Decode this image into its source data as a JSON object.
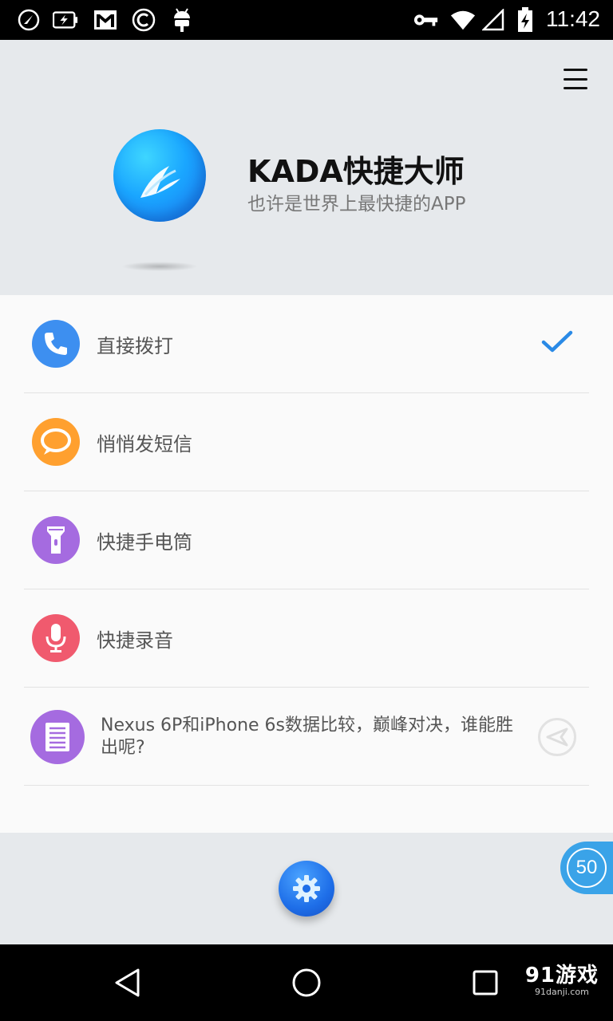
{
  "status_bar": {
    "time": "11:42",
    "left_icons": [
      "quick-app-icon",
      "battery-saver-icon",
      "gmail-icon",
      "copyright-app-icon",
      "android-debug-icon"
    ],
    "right_icons": [
      "vpn-key-icon",
      "wifi-icon",
      "cell-signal-icon",
      "battery-charging-icon"
    ]
  },
  "header": {
    "app_name": "KADA快捷大师",
    "tagline": "也许是世界上最快捷的APP",
    "colors": {
      "logo": "#1aa6ff",
      "background": "#e6e9ec"
    }
  },
  "items": [
    {
      "label": "直接拨打",
      "icon": "phone-icon",
      "color": "#3d8ff0",
      "checked": true
    },
    {
      "label": "悄悄发短信",
      "icon": "chat-bubble-icon",
      "color": "#ffa02f",
      "checked": false
    },
    {
      "label": "快捷手电筒",
      "icon": "flashlight-icon",
      "color": "#a56be0",
      "checked": false
    },
    {
      "label": "快捷录音",
      "icon": "microphone-icon",
      "color": "#f05a6e",
      "checked": false
    }
  ],
  "news": {
    "label": "Nexus 6P和iPhone 6s数据比较，巅峰对决，谁能胜出呢?",
    "icon": "document-icon",
    "color": "#a56be0"
  },
  "footer": {
    "badge_count": "50",
    "settings_icon": "gear-icon"
  },
  "nav": {
    "watermark_main": "91游戏",
    "watermark_sub": "91danji.com"
  },
  "accent_color": "#2a8ae6"
}
